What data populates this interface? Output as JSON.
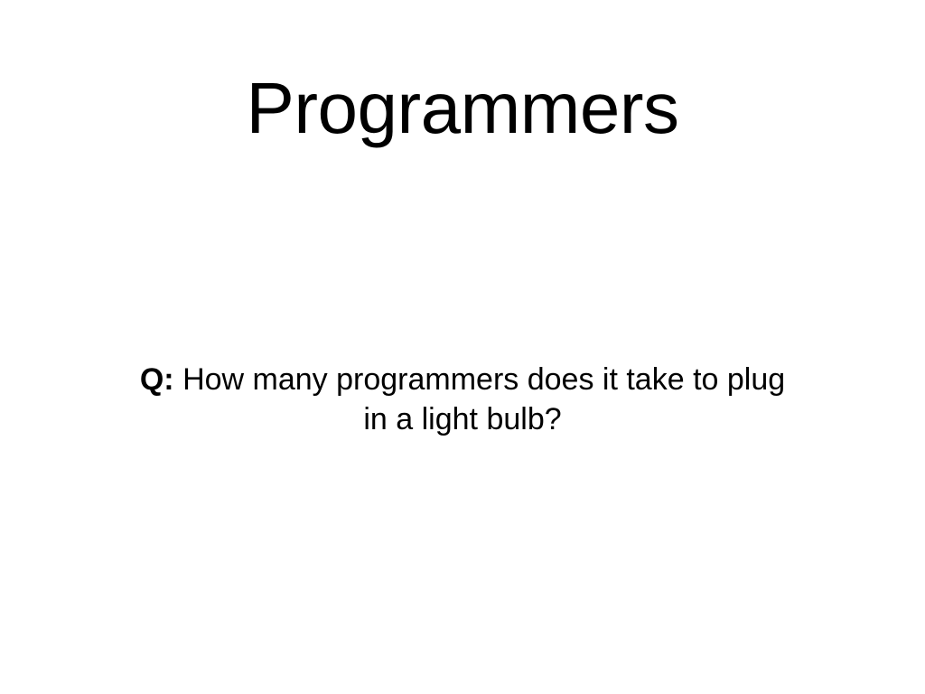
{
  "slide": {
    "title": "Programmers",
    "question": {
      "prefix": "Q:",
      "text": "How many programmers does it take to plug in a light bulb?"
    }
  }
}
